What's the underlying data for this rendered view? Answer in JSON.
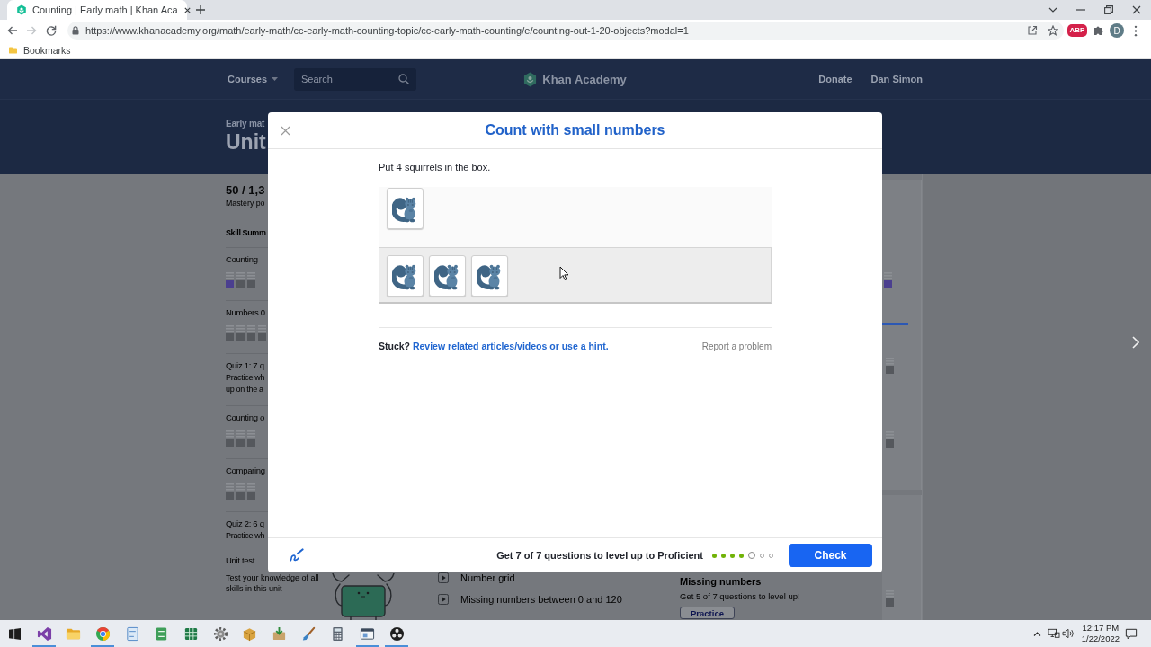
{
  "browser": {
    "tab": {
      "title": "Counting | Early math | Khan Aca"
    },
    "nav_buttons": [
      {
        "kind": "back",
        "disabled": false
      },
      {
        "kind": "forward",
        "disabled": true
      },
      {
        "kind": "reload",
        "disabled": false
      }
    ],
    "url": "https://www.khanacademy.org/math/early-math/cc-early-math-counting-topic/cc-early-math-counting/e/counting-out-1-20-objects?modal=1",
    "extensions": [
      {
        "kind": "adblock",
        "label": "ABP"
      },
      {
        "kind": "puzzle"
      }
    ],
    "profile": {
      "initial": "D"
    },
    "bookmarks": [
      {
        "label": "Bookmarks"
      }
    ]
  },
  "site_nav": {
    "courses": "Courses",
    "search": {
      "placeholder": "Search"
    },
    "logo": "Khan Academy",
    "links": [
      "Donate",
      "Dan Simon"
    ]
  },
  "unit_header": {
    "subject": "Early mat",
    "title": "Unit"
  },
  "sidebar": {
    "points": "50 / 1,3",
    "points_label": "Mastery po",
    "summary_title": "Skill Summ",
    "sections": [
      {
        "kind": "skill",
        "title": "Counting",
        "squares": [
          {
            "color": "#4b3f8f"
          },
          {
            "color": "#55585d"
          },
          {
            "color": "#55585d"
          }
        ]
      },
      {
        "kind": "skill",
        "title": "Numbers 0",
        "squares": [
          {
            "color": "#55585d"
          },
          {
            "color": "#55585d"
          },
          {
            "color": "#55585d"
          },
          {
            "color": "#55585d"
          }
        ]
      },
      {
        "kind": "quiz",
        "title": "Quiz 1: 7 q",
        "lines": [
          "Practice wh",
          "up on the a"
        ]
      },
      {
        "kind": "skill",
        "title": "Counting o",
        "squares": [
          {
            "color": "#55585d"
          },
          {
            "color": "#55585d"
          },
          {
            "color": "#55585d"
          }
        ]
      },
      {
        "kind": "skill",
        "title": "Comparing",
        "squares": [
          {
            "color": "#55585d"
          },
          {
            "color": "#55585d"
          },
          {
            "color": "#55585d"
          }
        ]
      },
      {
        "kind": "quiz",
        "title": "Quiz 2: 6 q",
        "lines": [
          "Practice wh"
        ]
      },
      {
        "kind": "test",
        "title": "Unit test",
        "description": "Test your knowledge of all skills in this unit"
      }
    ]
  },
  "lesson_list": [
    {
      "title": "Number grid"
    },
    {
      "title": "Missing numbers between 0 and 120"
    }
  ],
  "practice_card": {
    "title": "Missing numbers",
    "subtitle": "Get 5 of 7 questions to level up!",
    "button": "Practice"
  },
  "right_cards": {
    "indicators": [
      {
        "color": "#4b3f8f"
      },
      {
        "color": "#55585d"
      },
      {
        "color": "#55585d"
      },
      {
        "color": "#55585d"
      }
    ]
  },
  "modal": {
    "title": "Count with small numbers",
    "prompt": {
      "lead": "Put",
      "math": "4",
      "rest": "squirrels in the box."
    },
    "loose_items": [
      {
        "kind": "squirrel"
      }
    ],
    "box_items": [
      {
        "kind": "squirrel"
      },
      {
        "kind": "squirrel"
      },
      {
        "kind": "squirrel"
      }
    ],
    "stuck": {
      "label": "Stuck?",
      "link": "Review related articles/videos or use a hint."
    },
    "report": "Report a problem",
    "footer": {
      "goal": "Get 7 of 7 questions to level up to Proficient",
      "progress": [
        {
          "done": true,
          "selected": false
        },
        {
          "done": true,
          "selected": false
        },
        {
          "done": true,
          "selected": false
        },
        {
          "done": true,
          "selected": false
        },
        {
          "done": false,
          "selected": true
        },
        {
          "done": false,
          "selected": false
        },
        {
          "done": false,
          "selected": false
        }
      ],
      "check": "Check"
    }
  },
  "taskbar": {
    "apps": [
      {
        "kind": "ribbon",
        "running": true
      },
      {
        "kind": "folder",
        "running": false
      },
      {
        "kind": "browser",
        "running": true
      },
      {
        "kind": "document",
        "running": false
      },
      {
        "kind": "notepad",
        "running": false
      },
      {
        "kind": "spreadsheet",
        "running": false
      },
      {
        "kind": "gear",
        "running": false
      },
      {
        "kind": "package",
        "running": false
      },
      {
        "kind": "installer",
        "running": false
      },
      {
        "kind": "brush",
        "running": false
      },
      {
        "kind": "calculator",
        "running": false
      },
      {
        "kind": "window",
        "running": true
      },
      {
        "kind": "three-dot-circle",
        "running": true
      }
    ],
    "clock": {
      "time": "12:17 PM",
      "date": "1/22/2022"
    }
  }
}
